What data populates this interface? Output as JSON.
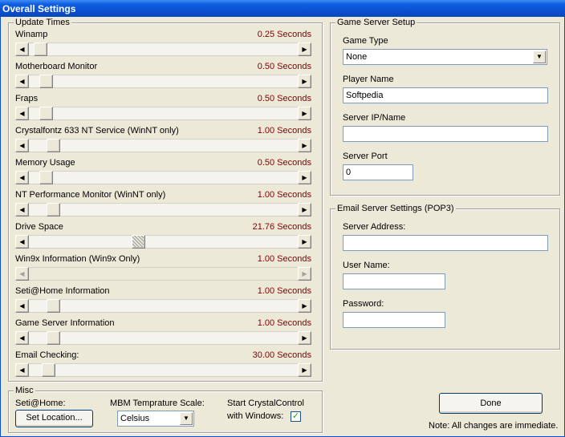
{
  "window": {
    "title": "Overall Settings"
  },
  "update_times": {
    "title": "Update Times",
    "items": [
      {
        "label": "Winamp",
        "value": "0.25 Seconds",
        "level": 0.02
      },
      {
        "label": "Motherboard Monitor",
        "value": "0.50 Seconds",
        "level": 0.04
      },
      {
        "label": "Fraps",
        "value": "0.50 Seconds",
        "level": 0.04
      },
      {
        "label": "Crystalfontz 633 NT Service (WinNT only)",
        "value": "1.00 Seconds",
        "level": 0.07
      },
      {
        "label": "Memory Usage",
        "value": "0.50 Seconds",
        "level": 0.04
      },
      {
        "label": "NT Performance Monitor (WinNT only)",
        "value": "1.00 Seconds",
        "level": 0.07
      },
      {
        "label": "Drive Space",
        "value": "21.76 Seconds",
        "level": 0.4
      },
      {
        "label": "Win9x Information (Win9x Only)",
        "value": "1.00 Seconds",
        "level": null
      },
      {
        "label": "Seti@Home Information",
        "value": "1.00 Seconds",
        "level": 0.07
      },
      {
        "label": "Game Server Information",
        "value": "1.00 Seconds",
        "level": 0.07
      },
      {
        "label": "Email Checking:",
        "value": "30.00 Seconds",
        "level": 0.05
      }
    ]
  },
  "misc": {
    "title": "Misc",
    "seti_label": "Seti@Home:",
    "set_location_button": "Set Location...",
    "temp_scale_label": "MBM Temprature Scale:",
    "temp_scale_value": "Celsius",
    "start_label_line1": "Start CrystalControl",
    "start_label_line2": "with Windows:",
    "start_checked": true
  },
  "game_server": {
    "title": "Game Server Setup",
    "game_type_label": "Game Type",
    "game_type_value": "None",
    "player_name_label": "Player Name",
    "player_name_value": "Softpedia",
    "server_ip_label": "Server IP/Name",
    "server_ip_value": "",
    "server_port_label": "Server Port",
    "server_port_value": "0"
  },
  "email_server": {
    "title": "Email Server Settings (POP3)",
    "address_label": "Server Address:",
    "address_value": "",
    "user_label": "User Name:",
    "user_value": "",
    "password_label": "Password:",
    "password_value": ""
  },
  "footer": {
    "done_button": "Done",
    "note": "Note: All changes are immediate."
  },
  "icons": {
    "scroll_left": "◀",
    "scroll_right": "▶",
    "dropdown": "▼",
    "check": "✓"
  }
}
